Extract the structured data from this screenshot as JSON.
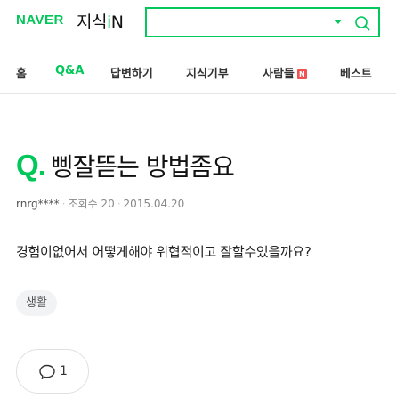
{
  "header": {
    "logo_naver": "NAVER",
    "logo_kin_prefix": "지식",
    "logo_kin_i": "i",
    "logo_kin_n": "N",
    "search": {
      "value": "",
      "placeholder": ""
    },
    "brand_color": "#03c75a"
  },
  "nav": {
    "items": [
      {
        "label": "홈"
      },
      {
        "label": "Q&A"
      },
      {
        "label": "답변하기"
      },
      {
        "label": "지식기부"
      },
      {
        "label": "사람들",
        "badge": "N"
      },
      {
        "label": "베스트"
      }
    ],
    "active": "Q&A"
  },
  "question": {
    "mark": "Q.",
    "title": "삥잘뜯는 방법좀요",
    "author": "rnrg****",
    "views": "조회수 20",
    "date": "2015.04.20",
    "body": "경험이없어서 어떻게해야 위협적이고 잘할수있을까요?",
    "tag": "생활",
    "comment_count": "1"
  },
  "icons": {
    "dropdown": "chevron-down-icon",
    "search": "search-icon",
    "comment": "comment-bubble-icon"
  }
}
